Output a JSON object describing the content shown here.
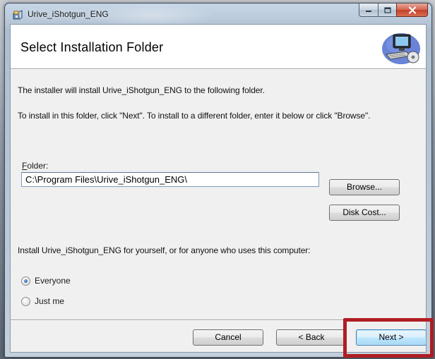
{
  "window": {
    "title": "Urive_iShotgun_ENG",
    "icons": {
      "app": "installer-package-icon",
      "minimize": "minimize-icon",
      "maximize": "maximize-icon",
      "close": "close-icon"
    }
  },
  "header": {
    "title": "Select Installation Folder",
    "graphic": "computer-setup-graphic"
  },
  "body": {
    "intro_line1": "The installer will install Urive_iShotgun_ENG to the following folder.",
    "intro_line2": "To install in this folder, click \"Next\". To install to a different folder, enter it below or click \"Browse\".",
    "folder_label_accel": "F",
    "folder_label_rest": "older:",
    "folder_value": "C:\\Program Files\\Urive_iShotgun_ENG\\",
    "browse_label": "Browse...",
    "disk_cost_label": "Disk Cost...",
    "scope_prompt": "Install Urive_iShotgun_ENG for yourself, or for anyone who uses this computer:",
    "options": [
      {
        "label": "Everyone",
        "checked": true
      },
      {
        "label": "Just me",
        "checked": false
      }
    ]
  },
  "footer": {
    "cancel_label": "Cancel",
    "back_label": "< Back",
    "next_label": "Next >"
  },
  "colors": {
    "highlight": "#b01e24",
    "default_button_border": "#3c7fb1"
  }
}
